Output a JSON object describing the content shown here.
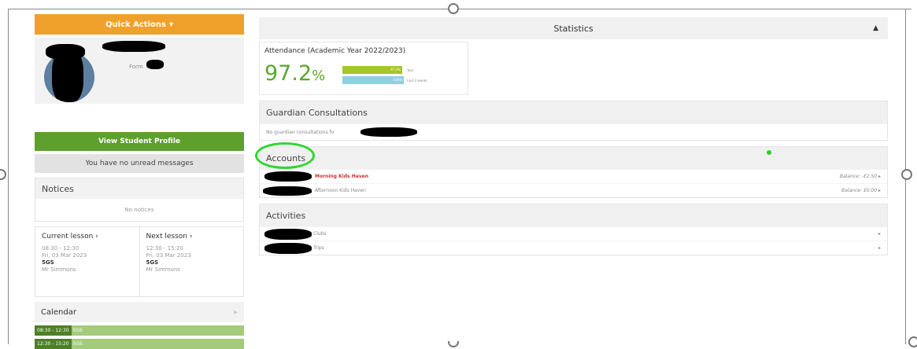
{
  "left": {
    "quick_actions_label": "Quick Actions",
    "form_label": "Form",
    "view_profile_label": "View Student Profile",
    "messages_label": "You have no unread messages",
    "notices": {
      "title": "Notices",
      "empty_text": "No notices"
    },
    "current_lesson": {
      "title": "Current lesson",
      "time": "08:30 - 12:30",
      "date": "Fri, 03 Mar 2023",
      "code": "5GS",
      "teacher": "Mr Simmons"
    },
    "next_lesson": {
      "title": "Next lesson",
      "time": "12:30 - 15:20",
      "date": "Fri, 03 Mar 2023",
      "code": "5GS",
      "teacher": "Mr Simmons"
    },
    "calendar": {
      "title": "Calendar",
      "events": [
        {
          "time": "08:30 - 12:30",
          "label": "5GS"
        },
        {
          "time": "12:30 - 15:20",
          "label": "5GS"
        }
      ]
    }
  },
  "right": {
    "statistics_title": "Statistics",
    "attendance": {
      "title": "Attendance (Academic Year 2022/2023)",
      "value": "97.2",
      "unit": "%",
      "year_bar_text": "97.2%",
      "year_label": "Year",
      "weeks_bar_text": "100%",
      "weeks_label": "Last 4 weeks",
      "year_fraction": 0.972,
      "weeks_fraction": 1.0,
      "year_color": "#a6c52a",
      "weeks_color": "#8fd0e2"
    },
    "guardian": {
      "title": "Guardian Consultations",
      "text": "No guardian consultations fo"
    },
    "accounts": {
      "title": "Accounts",
      "rows": [
        {
          "name": "Morning Kids Haven",
          "balance": "Balance: -£2.50"
        },
        {
          "name": "Afternoon Kids Haven",
          "balance": "Balance: £0.00"
        }
      ]
    },
    "activities": {
      "title": "Activities",
      "rows": [
        {
          "name": "Clubs"
        },
        {
          "name": "Trips"
        }
      ]
    }
  }
}
